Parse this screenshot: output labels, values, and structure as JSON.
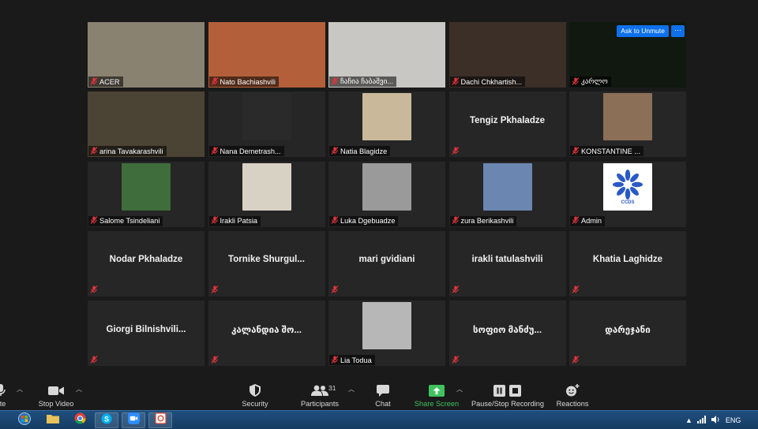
{
  "meeting": {
    "ask_to_unmute": "Ask to Unmute",
    "more": "···"
  },
  "participants": [
    {
      "name": "ACER",
      "video": true,
      "bg": "#8a8270"
    },
    {
      "name": "Nato Bachiashvili",
      "video": true,
      "bg": "#b3603a"
    },
    {
      "name": "ჩაჩია ჩაბაშვი...",
      "video": true,
      "bg": "#c9c7c3"
    },
    {
      "name": "Dachi Chkhartish...",
      "video": true,
      "bg": "#3b2f28"
    },
    {
      "name": "კარლო",
      "video": true,
      "bg": "#101810"
    },
    {
      "name": "arina Tavakarashvili",
      "video": true,
      "bg": "#4b4334",
      "active": true
    },
    {
      "name": "Nana Demetrash...",
      "photo": true,
      "bg": "#2a2a2a"
    },
    {
      "name": "Natia Blagidze",
      "photo": true,
      "bg": "#c9b99a"
    },
    {
      "name": "Tengiz Pkhaladze",
      "center": true
    },
    {
      "name": "KONSTANTINE ...",
      "photo": true,
      "bg": "#8c6f57"
    },
    {
      "name": "Salome Tsindeliani",
      "photo": true,
      "bg": "#3f6d3c"
    },
    {
      "name": "Irakli Patsia",
      "photo": true,
      "bg": "#d8d2c5"
    },
    {
      "name": "Luka Dgebuadze",
      "photo": true,
      "bg": "#9a9a9a"
    },
    {
      "name": "zura Berikashvili",
      "photo": true,
      "bg": "#6b86b0"
    },
    {
      "name": "Admin",
      "photo": true,
      "logo": "CCDS",
      "bg": "#ffffff"
    },
    {
      "name": "Nodar Pkhaladze",
      "center": true,
      "nolabel": true
    },
    {
      "name": "Tornike  Shurgul...",
      "center": true,
      "nolabel": true
    },
    {
      "name": "mari gvidiani",
      "center": true,
      "nolabel": true
    },
    {
      "name": "irakli tatulashvili",
      "center": true,
      "nolabel": true
    },
    {
      "name": "Khatia Laghidze",
      "center": true,
      "nolabel": true
    },
    {
      "name": "Giorgi  Bilnishvili...",
      "center": true,
      "nolabel": true
    },
    {
      "name": "კალანდია შო...",
      "center": true,
      "nolabel": true
    },
    {
      "name": "Lia Todua",
      "photo": true,
      "bg": "#b7b7b7"
    },
    {
      "name": "სოფიო მანძუ...",
      "center": true,
      "nolabel": true
    },
    {
      "name": "დარეჯანი",
      "center": true,
      "nolabel": true
    }
  ],
  "toolbar": {
    "mute_label": "ute",
    "stop_video_label": "Stop Video",
    "security_label": "Security",
    "participants_label": "Participants",
    "participants_count": "31",
    "chat_label": "Chat",
    "share_screen_label": "Share Screen",
    "recording_label": "Pause/Stop Recording",
    "reactions_label": "Reactions"
  },
  "taskbar": {
    "language": "ENG"
  },
  "colors": {
    "accent_blue": "#0e71eb",
    "share_green": "#3fc35f",
    "active_speaker": "#d6e44c",
    "muted_red": "#e0343d"
  }
}
